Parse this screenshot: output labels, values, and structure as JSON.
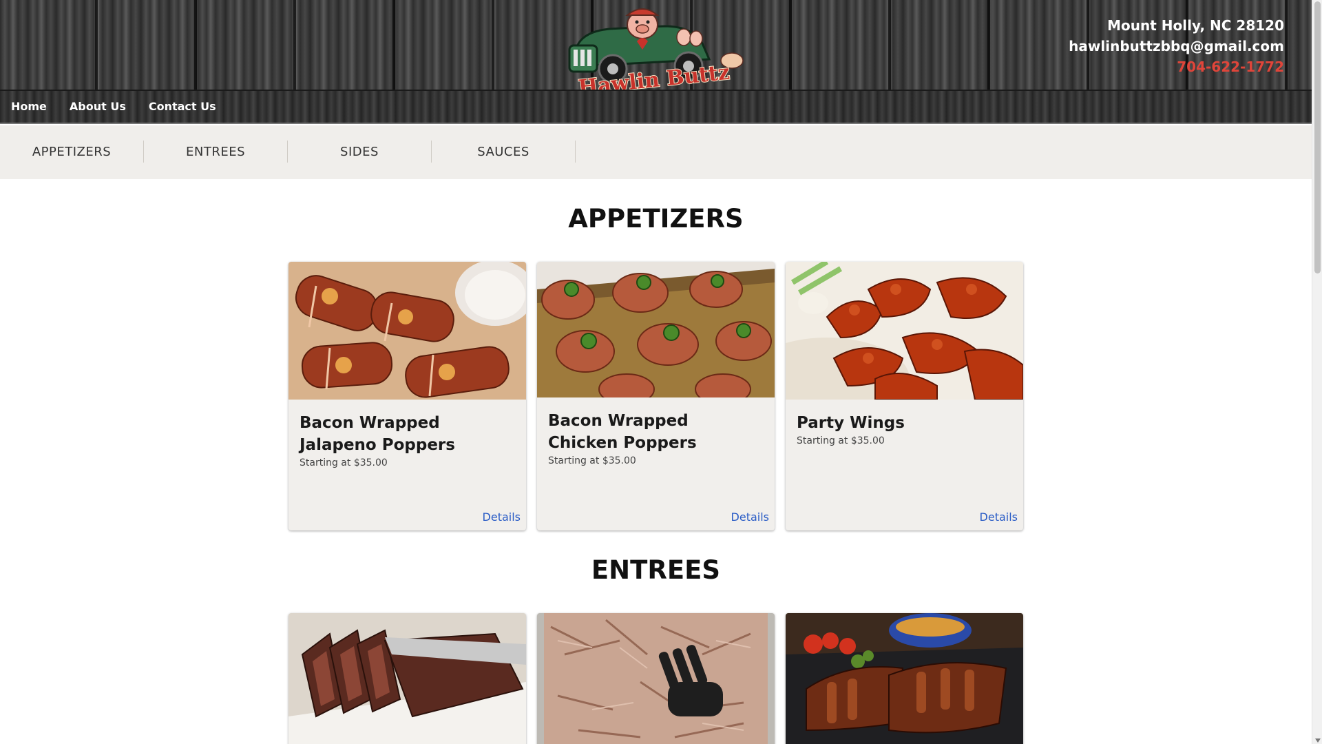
{
  "header": {
    "logo_alt": "Hawlin Buttz",
    "address": "Mount Holly, NC 28120",
    "email": "hawlinbuttzbbq@gmail.com",
    "phone": "704-622-1772",
    "phone_color": "#e0453a"
  },
  "nav": {
    "items": [
      {
        "label": "Home"
      },
      {
        "label": "About Us"
      },
      {
        "label": "Contact Us"
      }
    ]
  },
  "categories": {
    "tabs": [
      {
        "label": "APPETIZERS"
      },
      {
        "label": "ENTREES"
      },
      {
        "label": "SIDES"
      },
      {
        "label": "SAUCES"
      }
    ]
  },
  "sections": [
    {
      "title": "APPETIZERS",
      "items": [
        {
          "name": "Bacon Wrapped Jalapeno Poppers",
          "price": "Starting at $35.00",
          "link": "Details"
        },
        {
          "name": "Bacon Wrapped Chicken Poppers",
          "price": "Starting at $35.00",
          "link": "Details"
        },
        {
          "name": "Party Wings",
          "price": "Starting at $35.00",
          "link": "Details"
        }
      ]
    },
    {
      "title": "ENTREES",
      "items": []
    }
  ],
  "colors": {
    "link": "#2a5cc6",
    "catbar_bg": "#f0eeeb",
    "card_bg": "#f1efec"
  }
}
